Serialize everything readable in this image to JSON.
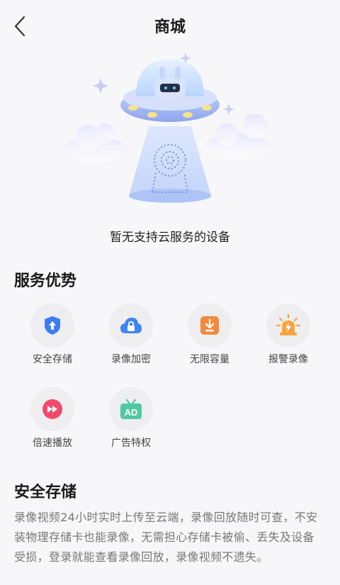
{
  "header": {
    "title": "商城",
    "back_icon": "chevron-left-icon"
  },
  "hero": {
    "empty_text": "暂无支持云服务的设备",
    "illustration": "ufo-camera-illustration"
  },
  "advantages": {
    "title": "服务优势",
    "items": [
      {
        "label": "安全存储",
        "icon": "shield-upload-icon",
        "color": "#3d7cf2"
      },
      {
        "label": "录像加密",
        "icon": "cloud-lock-icon",
        "color": "#3f86ef"
      },
      {
        "label": "无限容量",
        "icon": "download-icon",
        "color": "#f08a3e"
      },
      {
        "label": "报警录像",
        "icon": "alarm-light-icon",
        "color": "#f6a540"
      },
      {
        "label": "倍速播放",
        "icon": "fast-forward-icon",
        "color": "#f04a6a"
      },
      {
        "label": "广告特权",
        "icon": "ad-tv-icon",
        "color": "#4ec9a0"
      }
    ]
  },
  "detail": {
    "title": "安全存储",
    "text": "录像视频24小时实时上传至云端，录像回放随时可查，不安装物理存储卡也能录像，无需担心存储卡被偷、丢失及设备受损，登录就能查看录像回放，录像视频不遗失。"
  }
}
